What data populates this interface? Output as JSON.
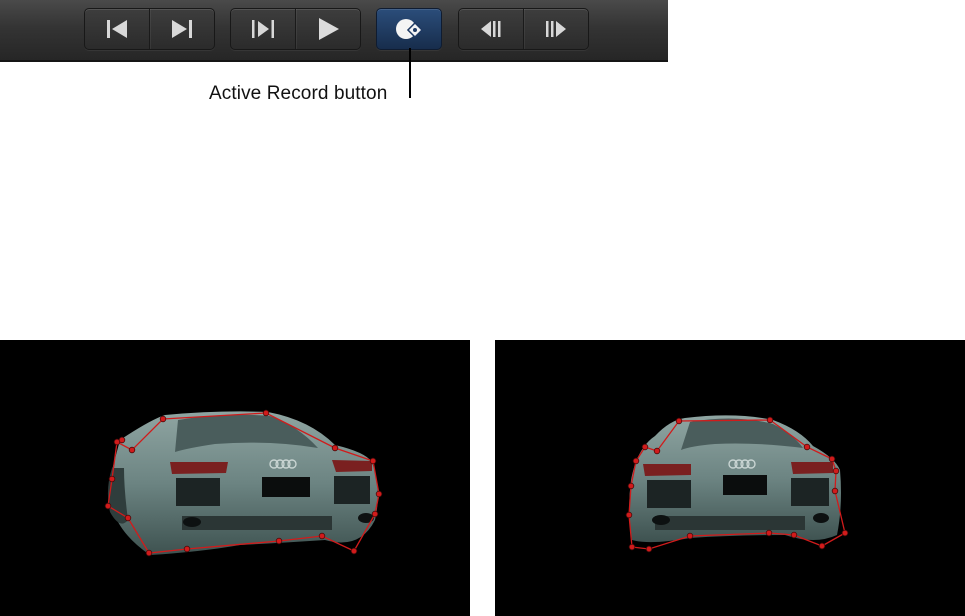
{
  "toolbar": {
    "buttons": [
      {
        "name": "go-to-start-button",
        "icon": "skip-to-start-icon"
      },
      {
        "name": "go-to-end-button",
        "icon": "skip-to-end-icon"
      },
      {
        "name": "play-from-start-button",
        "icon": "play-from-start-icon"
      },
      {
        "name": "play-button",
        "icon": "play-icon"
      },
      {
        "name": "record-button",
        "icon": "record-icon",
        "state": "active"
      },
      {
        "name": "previous-frame-button",
        "icon": "step-back-icon"
      },
      {
        "name": "next-frame-button",
        "icon": "step-forward-icon"
      }
    ],
    "active_color": "#1f3a63"
  },
  "callout": {
    "label": "Active Record button"
  },
  "viewers": [
    {
      "name": "viewer-before",
      "shape_stroke": "#d11b1b"
    },
    {
      "name": "viewer-after",
      "shape_stroke": "#d11b1b"
    }
  ]
}
